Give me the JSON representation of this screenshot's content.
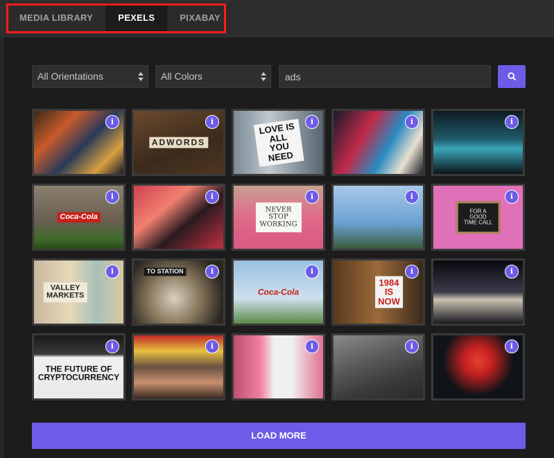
{
  "tabs": [
    {
      "label": "MEDIA LIBRARY"
    },
    {
      "label": "PEXELS"
    },
    {
      "label": "PIXABAY"
    }
  ],
  "active_tab": "PEXELS",
  "filters": {
    "orientation": "All Orientations",
    "color": "All Colors",
    "search_value": "ads"
  },
  "colors": {
    "accent": "#6c5ce7",
    "highlight": "#ff1a1a"
  },
  "images": [
    {
      "caption": "",
      "icon": "info-icon"
    },
    {
      "caption": "ADWORDS",
      "icon": "info-icon"
    },
    {
      "caption": "LOVE IS\nALL YOU\nNEED",
      "icon": "info-icon"
    },
    {
      "caption": "",
      "icon": "info-icon"
    },
    {
      "caption": "",
      "icon": "info-icon"
    },
    {
      "caption": "Coca-Cola",
      "icon": "info-icon"
    },
    {
      "caption": "",
      "icon": "info-icon"
    },
    {
      "caption": "NEVER\nSTOP\nWORKING",
      "icon": "info-icon"
    },
    {
      "caption": "",
      "icon": "info-icon"
    },
    {
      "caption": "FOR A\nGOOD TIME CALL",
      "icon": "info-icon"
    },
    {
      "caption": "VALLEY\nMARKETS",
      "icon": "info-icon"
    },
    {
      "caption": "TO STATION",
      "icon": "info-icon"
    },
    {
      "caption": "Coca-Cola",
      "icon": "info-icon"
    },
    {
      "caption": "1984\nIS\nNOW",
      "icon": "info-icon"
    },
    {
      "caption": "",
      "icon": "info-icon"
    },
    {
      "caption": "THE FUTURE OF\nCRYPTOCURRENCY",
      "icon": "info-icon"
    },
    {
      "caption": "",
      "icon": "info-icon"
    },
    {
      "caption": "",
      "icon": "info-icon"
    },
    {
      "caption": "",
      "icon": "info-icon"
    },
    {
      "caption": "",
      "icon": "info-icon"
    }
  ],
  "load_more_label": "LOAD MORE"
}
